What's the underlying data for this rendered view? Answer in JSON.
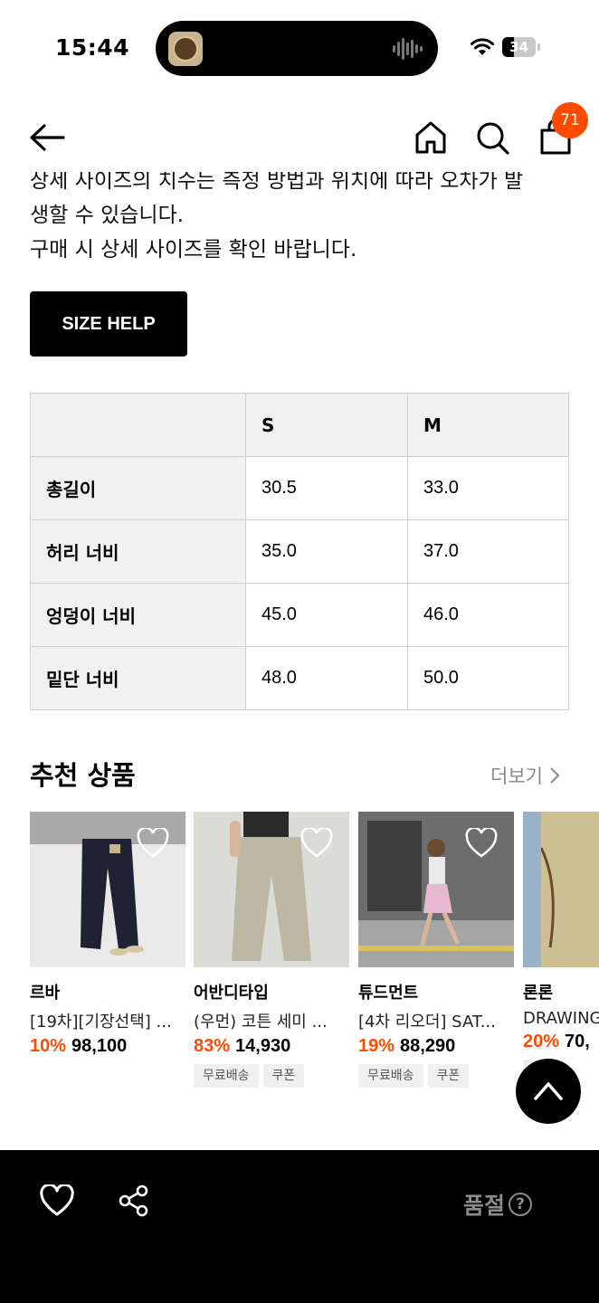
{
  "status_bar": {
    "time": "15:44",
    "battery": "34",
    "battery_level": 0.34
  },
  "nav": {
    "cart_count": "71"
  },
  "description": {
    "line1": "상세 사이즈의 치수는 측정 방법과 위치에 따라 오차가 발",
    "line2": "생할 수 있습니다.",
    "line3": "구매 시 상세 사이즈를 확인 바랍니다."
  },
  "size_help_label": "SIZE HELP",
  "size_table": {
    "headers": [
      "",
      "S",
      "M"
    ],
    "rows": [
      {
        "label": "총길이",
        "s": "30.5",
        "m": "33.0"
      },
      {
        "label": "허리 너비",
        "s": "35.0",
        "m": "37.0"
      },
      {
        "label": "엉덩이 너비",
        "s": "45.0",
        "m": "46.0"
      },
      {
        "label": "밑단 너비",
        "s": "48.0",
        "m": "50.0"
      }
    ]
  },
  "recommend": {
    "title": "추천 상품",
    "more": "더보기",
    "products": [
      {
        "brand": "르바",
        "name": "[19차][기장선택] ...",
        "discount": "10%",
        "price": "98,100",
        "tags": []
      },
      {
        "brand": "어반디타입",
        "name": "(우먼) 코튼 세미 ...",
        "discount": "83%",
        "price": "14,930",
        "tags": [
          "무료배송",
          "쿠폰"
        ]
      },
      {
        "brand": "튜드먼트",
        "name": "[4차 리오더] SAT...",
        "discount": "19%",
        "price": "88,290",
        "tags": [
          "무료배송",
          "쿠폰"
        ]
      },
      {
        "brand": "론론",
        "name": "DRAWING",
        "discount": "20%",
        "price": "70,",
        "tags": [
          "송"
        ]
      }
    ]
  },
  "bottom_bar": {
    "soldout_label": "품절",
    "help": "?"
  },
  "icons": [
    "back-arrow-icon",
    "home-icon",
    "search-icon",
    "shopping-bag-icon",
    "heart-icon",
    "share-icon",
    "chevron-right-icon",
    "chevron-up-icon",
    "wifi-icon",
    "battery-icon"
  ],
  "colors": {
    "accent": "#ff4b00",
    "black": "#000000",
    "gray_text": "#8a8a8a",
    "table_header": "#f1f1f1"
  }
}
